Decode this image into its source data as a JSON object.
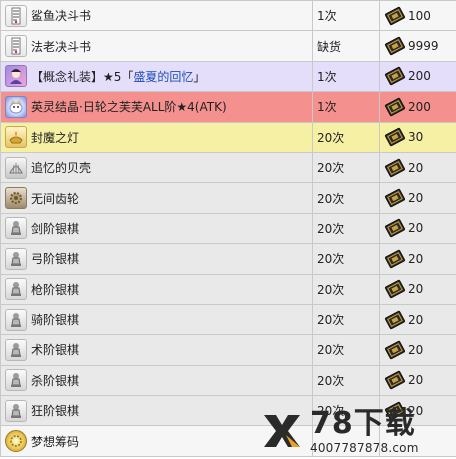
{
  "rows": [
    {
      "name": "鲨鱼决斗书",
      "limit": "1次",
      "price": "100",
      "icon": "scroll-icon",
      "style": "default"
    },
    {
      "name": "法老决斗书",
      "limit": "缺货",
      "price": "9999",
      "icon": "scroll-icon",
      "style": "default"
    },
    {
      "name_prefix": "【概念礼装】★5「",
      "name_link": "盛夏的回忆",
      "name_suffix": "」",
      "limit": "1次",
      "price": "200",
      "icon": "craft-essence-icon",
      "style": "purple"
    },
    {
      "name": "英灵结晶·日轮之芙芙ALL阶★4(ATK)",
      "limit": "1次",
      "price": "200",
      "icon": "fou-crystal-icon",
      "style": "red"
    },
    {
      "name": "封魔之灯",
      "limit": "20次",
      "price": "30",
      "icon": "lamp-icon",
      "style": "yellow"
    },
    {
      "name": "追忆的贝壳",
      "limit": "20次",
      "price": "20",
      "icon": "shell-icon",
      "style": "gray"
    },
    {
      "name": "无间齿轮",
      "limit": "20次",
      "price": "20",
      "icon": "gear-icon",
      "style": "gray"
    },
    {
      "name": "剑阶银棋",
      "limit": "20次",
      "price": "20",
      "icon": "silver-piece-icon",
      "style": "gray"
    },
    {
      "name": "弓阶银棋",
      "limit": "20次",
      "price": "20",
      "icon": "silver-piece-icon",
      "style": "gray"
    },
    {
      "name": "枪阶银棋",
      "limit": "20次",
      "price": "20",
      "icon": "silver-piece-icon",
      "style": "gray"
    },
    {
      "name": "骑阶银棋",
      "limit": "20次",
      "price": "20",
      "icon": "silver-piece-icon",
      "style": "gray"
    },
    {
      "name": "术阶银棋",
      "limit": "20次",
      "price": "20",
      "icon": "silver-piece-icon",
      "style": "gray"
    },
    {
      "name": "杀阶银棋",
      "limit": "20次",
      "price": "20",
      "icon": "silver-piece-icon",
      "style": "gray"
    },
    {
      "name": "狂阶银棋",
      "limit": "20次",
      "price": "20",
      "icon": "silver-piece-icon",
      "style": "gray"
    },
    {
      "name": "梦想筹码",
      "limit": "",
      "price": "",
      "icon": "chip-icon",
      "style": "default"
    }
  ],
  "watermark": {
    "brand": "78下载",
    "url": "4007787878.com"
  },
  "colors": {
    "purple_row": "#e4defb",
    "red_row": "#f4908d",
    "yellow_row": "#f6f0a5",
    "gray_row": "#e9e9e9",
    "link": "#1f4fb5"
  }
}
